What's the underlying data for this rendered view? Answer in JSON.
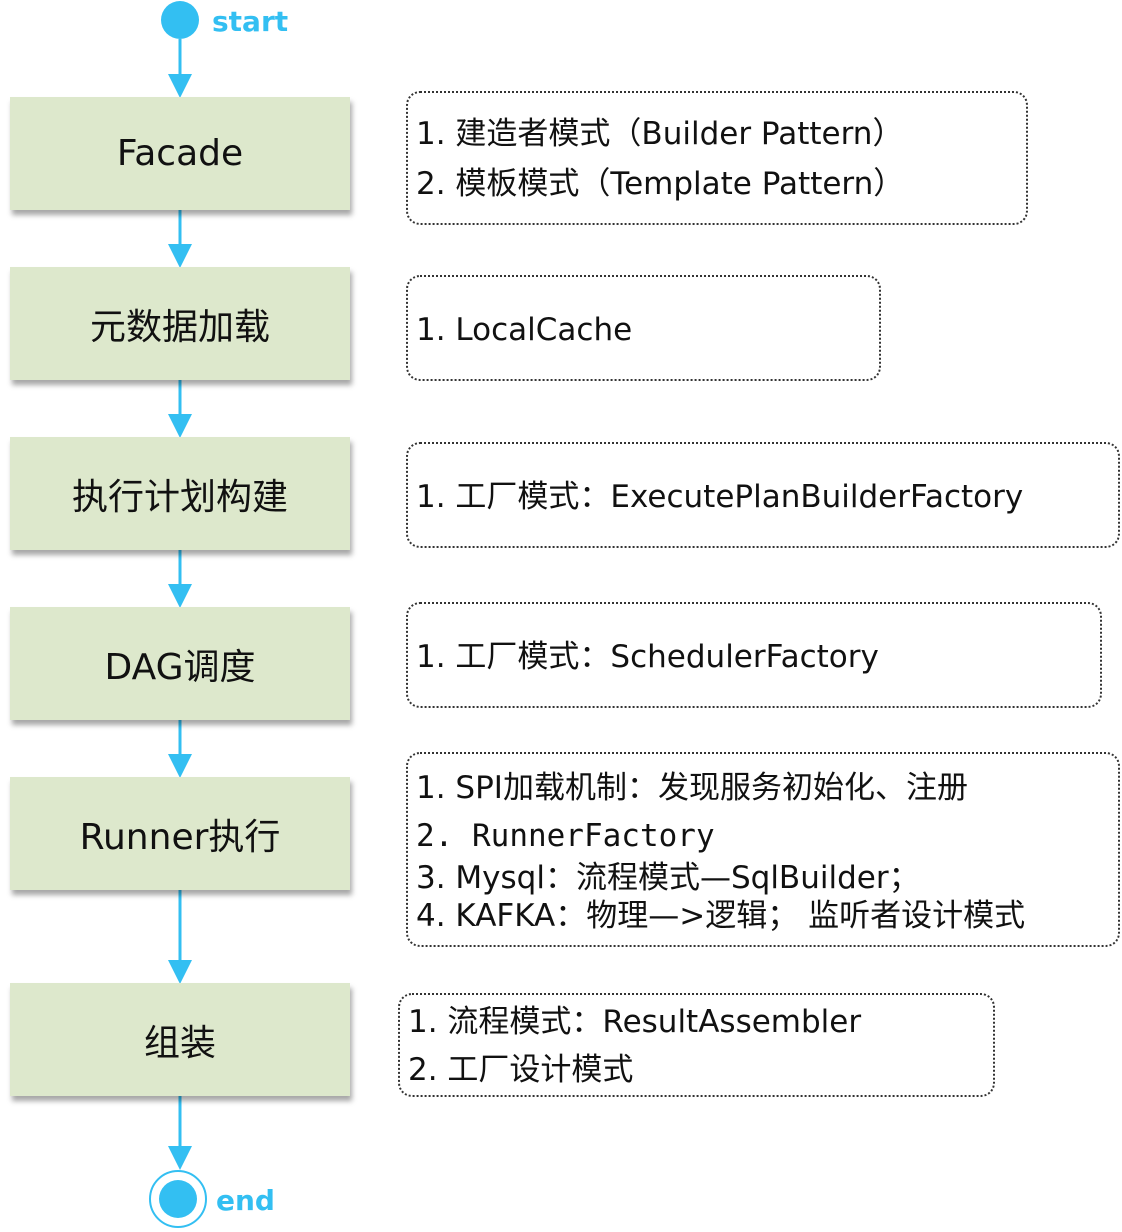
{
  "terminals": {
    "start_label": "start",
    "end_label": "end"
  },
  "steps": [
    {
      "label": "Facade"
    },
    {
      "label": "元数据加载"
    },
    {
      "label": "执行计划构建"
    },
    {
      "label": "DAG调度"
    },
    {
      "label": "Runner执行"
    },
    {
      "label": "组装"
    }
  ],
  "notes": [
    {
      "lines": [
        "1. 建造者模式（Builder Pattern）",
        "2. 模板模式（Template Pattern）"
      ]
    },
    {
      "lines": [
        "1. LocalCache"
      ]
    },
    {
      "lines": [
        "1. 工厂模式：ExecutePlanBuilderFactory"
      ]
    },
    {
      "lines": [
        "1. 工厂模式：SchedulerFactory"
      ]
    },
    {
      "lines": [
        "1. SPI加载机制：发现服务初始化、注册",
        "2. RunnerFactory",
        "3. Mysql：流程模式—SqlBuilder；",
        "4. KAFKA：物理—>逻辑；  监听者设计模式"
      ]
    },
    {
      "lines": [
        "1. 流程模式：ResultAssembler",
        "2. 工厂设计模式"
      ]
    }
  ],
  "colors": {
    "accent": "#33bff2",
    "step_fill": "#dde8cc",
    "note_border": "#333333",
    "text": "#111111"
  }
}
